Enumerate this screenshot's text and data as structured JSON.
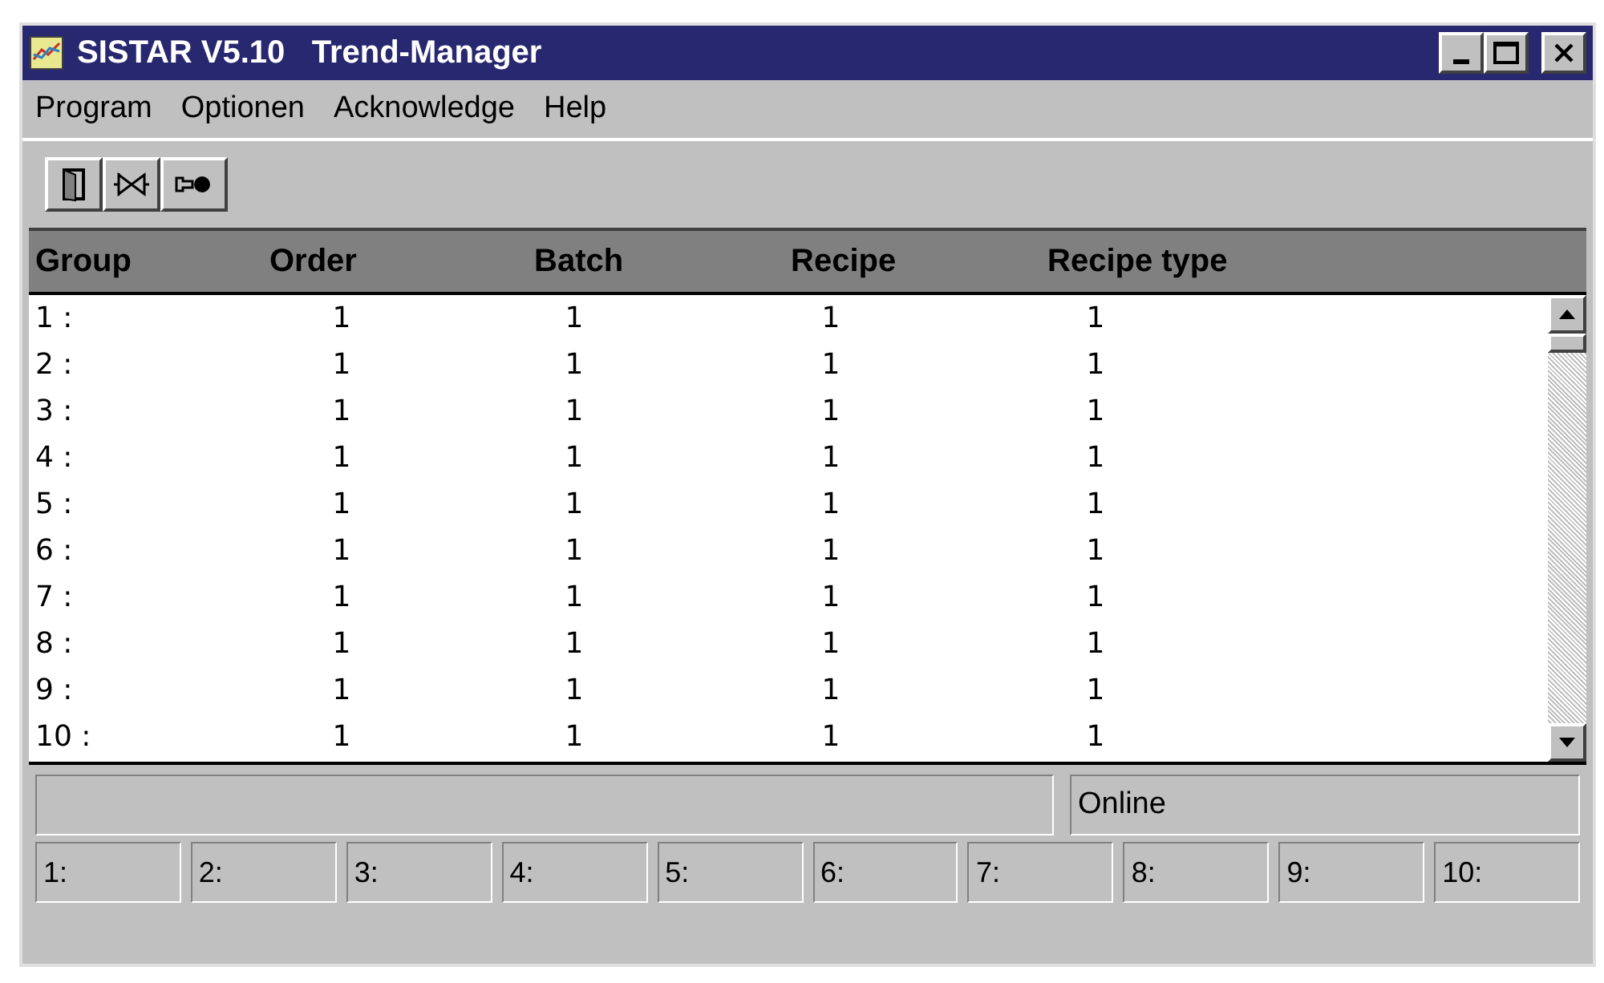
{
  "window": {
    "title": "SISTAR V5.10   Trend-Manager"
  },
  "menu": [
    "Program",
    "Optionen",
    "Acknowledge",
    "Help"
  ],
  "table": {
    "columns": [
      "Group",
      "Order",
      "Batch",
      "Recipe",
      "Recipe type"
    ],
    "rows": [
      [
        "1 :",
        "1",
        "1",
        "1",
        "1"
      ],
      [
        "2 :",
        "1",
        "1",
        "1",
        "1"
      ],
      [
        "3 :",
        "1",
        "1",
        "1",
        "1"
      ],
      [
        "4 :",
        "1",
        "1",
        "1",
        "1"
      ],
      [
        "5 :",
        "1",
        "1",
        "1",
        "1"
      ],
      [
        "6 :",
        "1",
        "1",
        "1",
        "1"
      ],
      [
        "7 :",
        "1",
        "1",
        "1",
        "1"
      ],
      [
        "8 :",
        "1",
        "1",
        "1",
        "1"
      ],
      [
        "9 :",
        "1",
        "1",
        "1",
        "1"
      ],
      [
        "10 :",
        "1",
        "1",
        "1",
        "1"
      ]
    ]
  },
  "status_bar": {
    "status": "Online"
  },
  "group_panels": [
    "1:",
    "2:",
    "3:",
    "4:",
    "5:",
    "6:",
    "7:",
    "8:",
    "9:",
    "10:"
  ]
}
